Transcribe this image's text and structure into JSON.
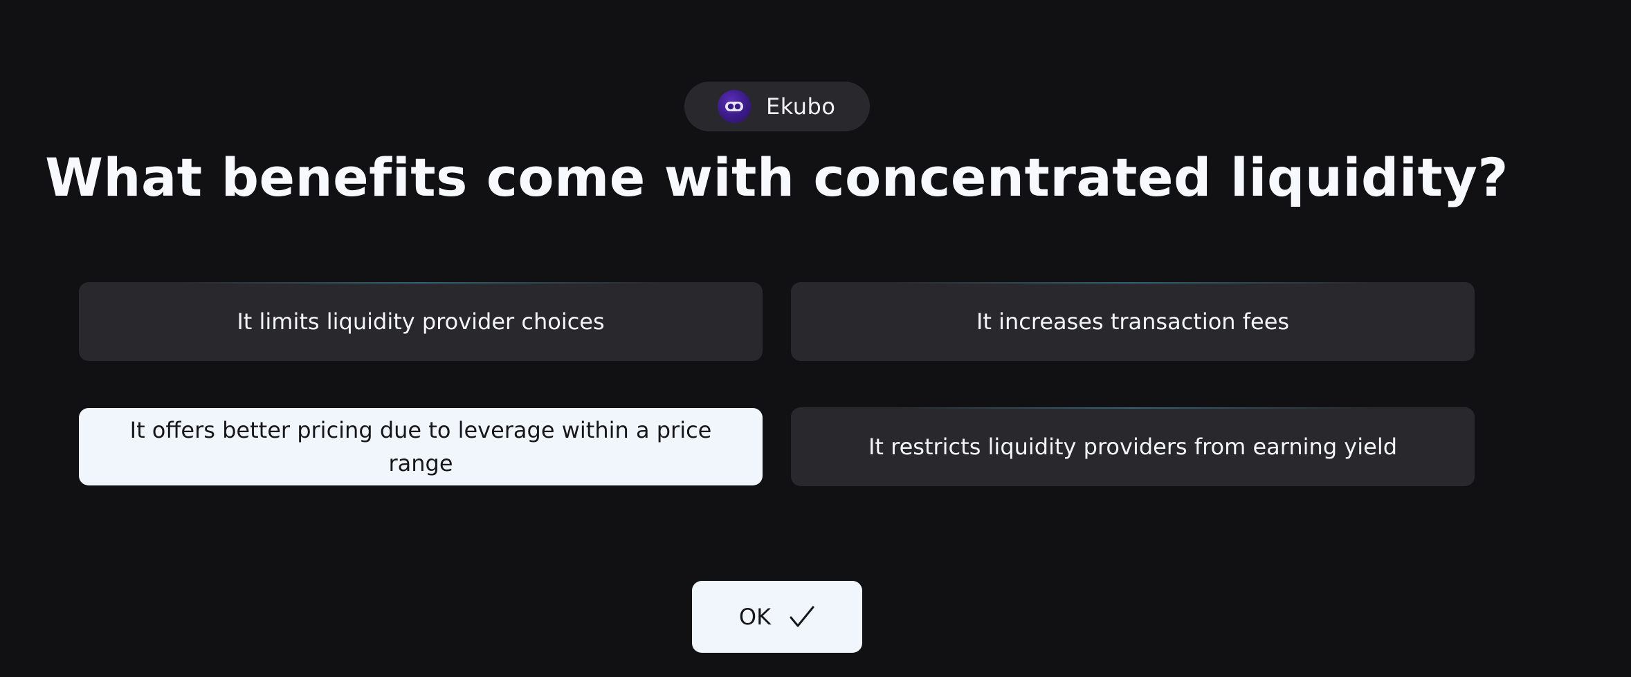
{
  "brand": {
    "name": "Ekubo",
    "logo_icon": "ekubo-logo-icon",
    "logo_color": "#4a24a4"
  },
  "question": "What benefits come with concentrated liquidity?",
  "options": [
    {
      "label": "It limits liquidity provider choices",
      "selected": false
    },
    {
      "label": "It increases transaction fees",
      "selected": false
    },
    {
      "label": "It offers better pricing due to leverage within a price range",
      "selected": true
    },
    {
      "label": "It restricts liquidity providers from earning yield",
      "selected": false
    }
  ],
  "ok_button": {
    "label": "OK",
    "icon": "checkmark-icon"
  },
  "colors": {
    "background": "#111113",
    "card": "#29292d",
    "selected_card": "#f1f6fd"
  }
}
